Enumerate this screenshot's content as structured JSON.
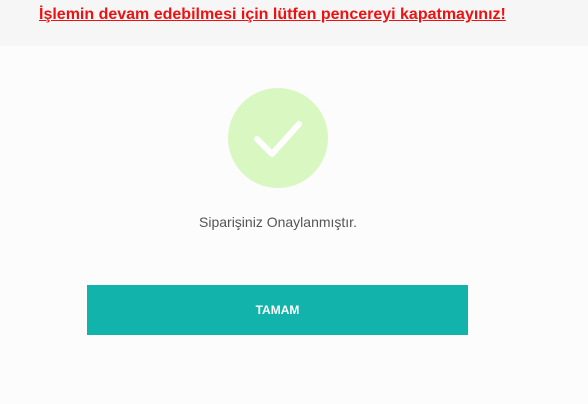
{
  "banner": {
    "warning_text": "İşlemin devam edebilmesi için lütfen pencereyi kapatmayınız!",
    "text_color": "#ee1111",
    "background": "#f6f6f6"
  },
  "status": {
    "icon": "checkmark-icon",
    "icon_bg_color": "#d9f7c1",
    "message": "Siparişiniz Onaylanmıştır."
  },
  "actions": {
    "ok_label": "TAMAM",
    "ok_color": "#12b3ab"
  }
}
